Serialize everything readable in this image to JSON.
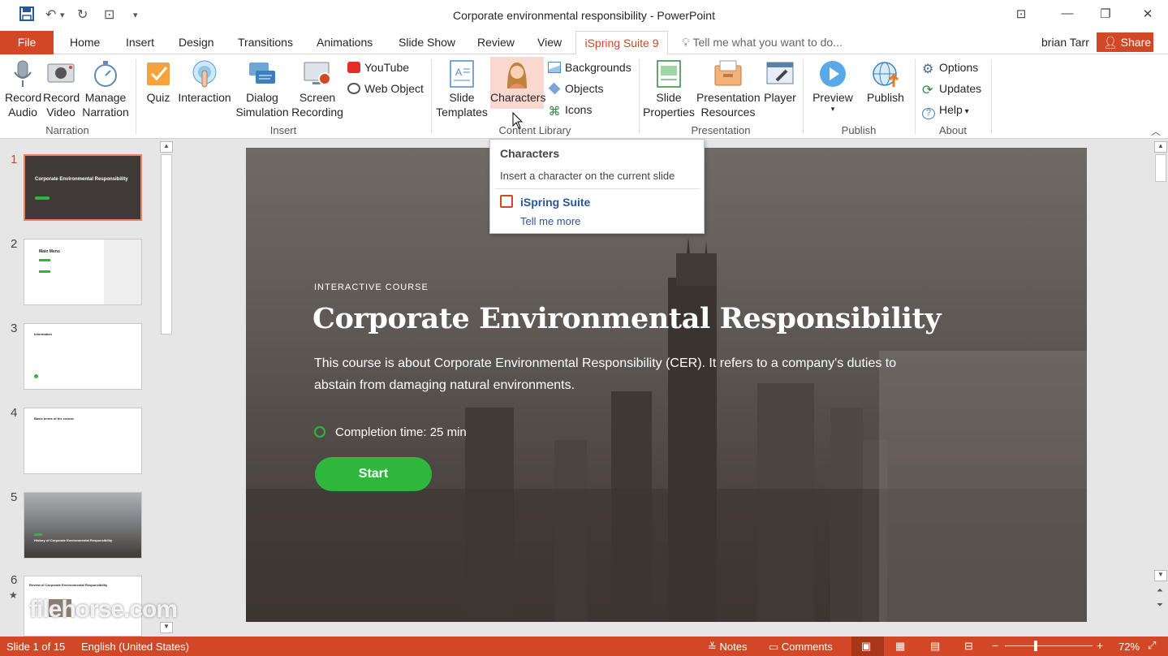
{
  "window": {
    "title": "Corporate environmental responsibility - PowerPoint"
  },
  "tabs": [
    "File",
    "Home",
    "Insert",
    "Design",
    "Transitions",
    "Animations",
    "Slide Show",
    "Review",
    "View",
    "iSpring Suite 9"
  ],
  "tell_me": "Tell me what you want to do...",
  "user": "brian Tarr",
  "share": "Share",
  "ribbon": {
    "narration": {
      "record_audio": "Record Audio",
      "record_video": "Record Video",
      "manage_narration": "Manage Narration",
      "group": "Narration"
    },
    "insert": {
      "quiz": "Quiz",
      "interaction": "Interaction",
      "dialog_simulation": "Dialog Simulation",
      "screen_recording": "Screen Recording",
      "youtube": "YouTube",
      "web_object": "Web Object",
      "group": "Insert"
    },
    "content_library": {
      "slide_templates": "Slide Templates",
      "characters": "Characters",
      "backgrounds": "Backgrounds",
      "objects": "Objects",
      "icons": "Icons",
      "group": "Content Library"
    },
    "presentation": {
      "slide_properties": "Slide Properties",
      "presentation_resources": "Presentation Resources",
      "player": "Player",
      "group": "Presentation"
    },
    "publish": {
      "preview": "Preview",
      "publish": "Publish",
      "group": "Publish"
    },
    "about": {
      "options": "Options",
      "updates": "Updates",
      "help": "Help",
      "group": "About"
    }
  },
  "tooltip": {
    "title": "Characters",
    "desc": "Insert a character on the current slide",
    "brand": "iSpring Suite",
    "link": "Tell me more"
  },
  "slides": [
    "1",
    "2",
    "3",
    "4",
    "5",
    "6"
  ],
  "thumb_texts": {
    "s1": "Corporate Environmental Responsibility",
    "s2": "Main Menu",
    "s3": "Information",
    "s4": "Basic terms of the course",
    "s5": "History of Corporate Environmental Responsibility",
    "s6": "Review of Corporate Environmental Responsibility"
  },
  "slide": {
    "kicker": "INTERACTIVE COURSE",
    "title": "Corporate Environmental Responsibility",
    "body": "This course is about Corporate Environmental Responsibility (CER). It refers to a company's duties to abstain from damaging natural environments.",
    "completion": "Completion time: 25 min",
    "start": "Start"
  },
  "status": {
    "slide": "Slide 1 of 15",
    "language": "English (United States)",
    "notes": "Notes",
    "comments": "Comments",
    "zoom": "72%"
  },
  "watermark": "filehorse.com",
  "colors": {
    "accent": "#d24726",
    "green": "#2db83d",
    "ispring_blue": "#2b5797"
  }
}
